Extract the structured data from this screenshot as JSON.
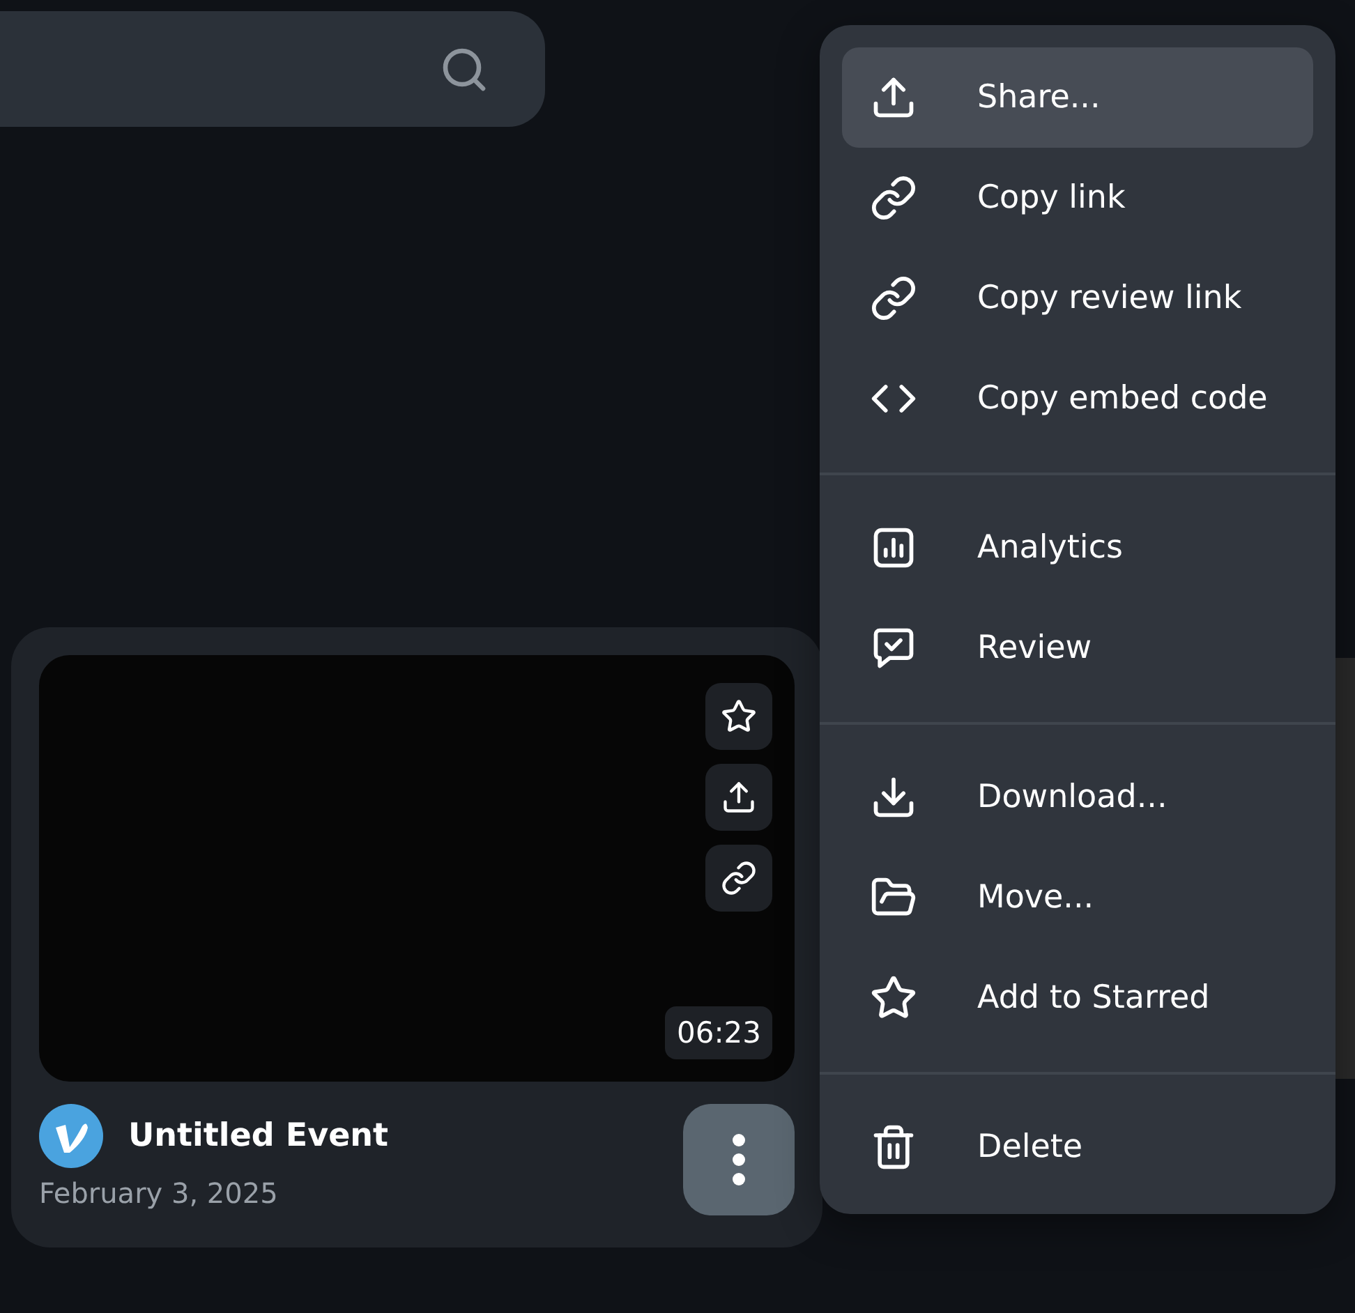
{
  "card": {
    "title": "Untitled Event",
    "date": "February 3, 2025",
    "duration": "06:23",
    "actions": [
      {
        "kind": "star"
      },
      {
        "kind": "share"
      },
      {
        "kind": "link"
      }
    ]
  },
  "menu": {
    "sections": [
      [
        {
          "label": "Share...",
          "kind": "share",
          "selected": true
        },
        {
          "label": "Copy link",
          "kind": "link",
          "selected": false
        },
        {
          "label": "Copy review link",
          "kind": "link",
          "selected": false
        },
        {
          "label": "Copy embed code",
          "kind": "code",
          "selected": false
        }
      ],
      [
        {
          "label": "Analytics",
          "kind": "analytics",
          "selected": false
        },
        {
          "label": "Review",
          "kind": "review",
          "selected": false
        }
      ],
      [
        {
          "label": "Download...",
          "kind": "download",
          "selected": false
        },
        {
          "label": "Move...",
          "kind": "folder",
          "selected": false
        },
        {
          "label": "Add to Starred",
          "kind": "star",
          "selected": false
        }
      ],
      [
        {
          "label": "Delete",
          "kind": "trash",
          "selected": false
        }
      ]
    ]
  }
}
